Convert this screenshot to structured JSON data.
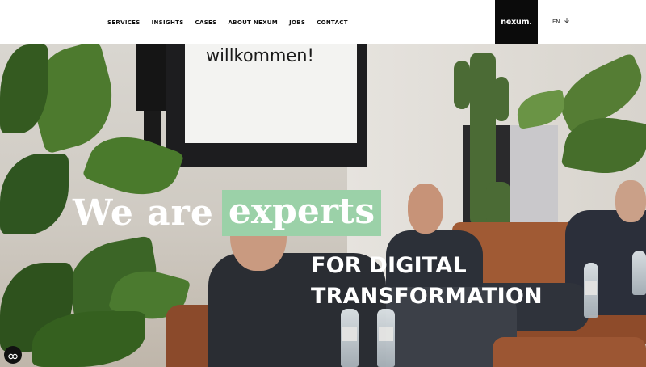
{
  "header": {
    "nav": [
      {
        "label": "SERVICES"
      },
      {
        "label": "INSIGHTS"
      },
      {
        "label": "CASES"
      },
      {
        "label": "ABOUT NEXUM"
      },
      {
        "label": "JOBS"
      },
      {
        "label": "CONTACT"
      }
    ],
    "logo_text": "nexum.",
    "language": "EN"
  },
  "hero": {
    "tv_text": "willkommen!",
    "headline_part1": "We are",
    "headline_highlight": "experts",
    "headline_line2": "FOR DIGITAL",
    "headline_line3": "TRANSFORMATION",
    "highlight_color": "#9bd1a8"
  },
  "icons": {
    "cookie": "cookie-settings-icon",
    "language_chevron": "chevron-down-icon"
  }
}
